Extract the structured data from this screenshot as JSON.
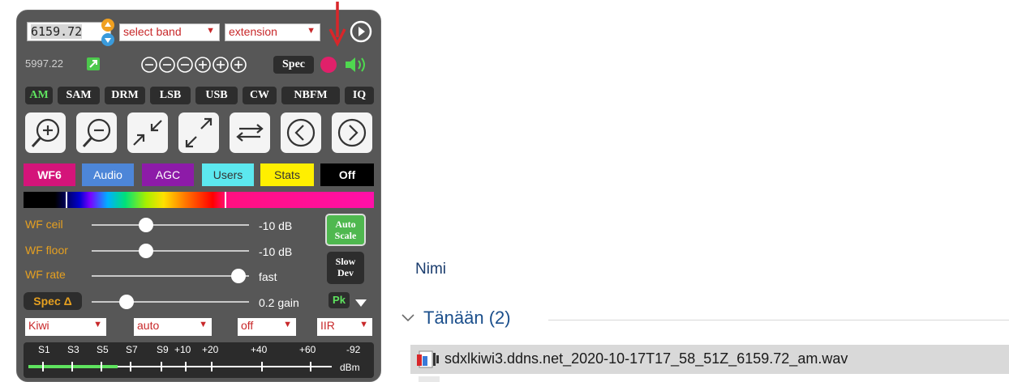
{
  "panel": {
    "frequency": "6159.72",
    "band_select": "select band",
    "extension_select": "extension",
    "secondary_freq": "5997.22",
    "spec_label": "Spec",
    "modes": [
      "AM",
      "SAM",
      "DRM",
      "LSB",
      "USB",
      "CW",
      "NBFM",
      "IQ"
    ],
    "active_mode": "AM",
    "tabs": [
      {
        "label": "WF6",
        "bg": "#d4147a",
        "color": "#ffffff"
      },
      {
        "label": "Audio",
        "bg": "#4d86d8",
        "color": "#ffffff"
      },
      {
        "label": "AGC",
        "bg": "#8d1ba8",
        "color": "#ffffff"
      },
      {
        "label": "Users",
        "bg": "#5ce8ef",
        "color": "#333333"
      },
      {
        "label": "Stats",
        "bg": "#ffef00",
        "color": "#333333"
      },
      {
        "label": "Off",
        "bg": "#000000",
        "color": "#ffffff"
      }
    ],
    "sliders": [
      {
        "label": "WF ceil",
        "value": "-10 dB",
        "level": 0.36
      },
      {
        "label": "WF floor",
        "value": "-10 dB",
        "level": 0.36
      },
      {
        "label": "WF rate",
        "value": "fast",
        "level": 1.0
      },
      {
        "label": "Spec Δ",
        "value": "0.2 gain",
        "level": 0.2
      }
    ],
    "auto_scale": [
      "Auto",
      "Scale"
    ],
    "slow_dev": [
      "Slow",
      "Dev"
    ],
    "pk_label": "Pk",
    "bottom_selects": [
      "Kiwi",
      "auto",
      "off",
      "IIR"
    ],
    "smeter_labels": [
      "S1",
      "S3",
      "S5",
      "S7",
      "S9",
      "+10",
      "+20",
      "+40",
      "+60",
      "-92",
      "dBm"
    ]
  },
  "explorer": {
    "column_header": "Nimi",
    "group_label": "Tänään (2)",
    "file_name": "sdxlkiwi3.ddns.net_2020-10-17T17_58_51Z_6159.72_am.wav"
  },
  "colors": {
    "panel_bg": "#575757",
    "accent_green": "#5fe35f",
    "label_orange": "#e6a020",
    "select_text": "#c8282a",
    "arrow_red": "#d8262a",
    "explorer_text": "#1b3d6e"
  }
}
